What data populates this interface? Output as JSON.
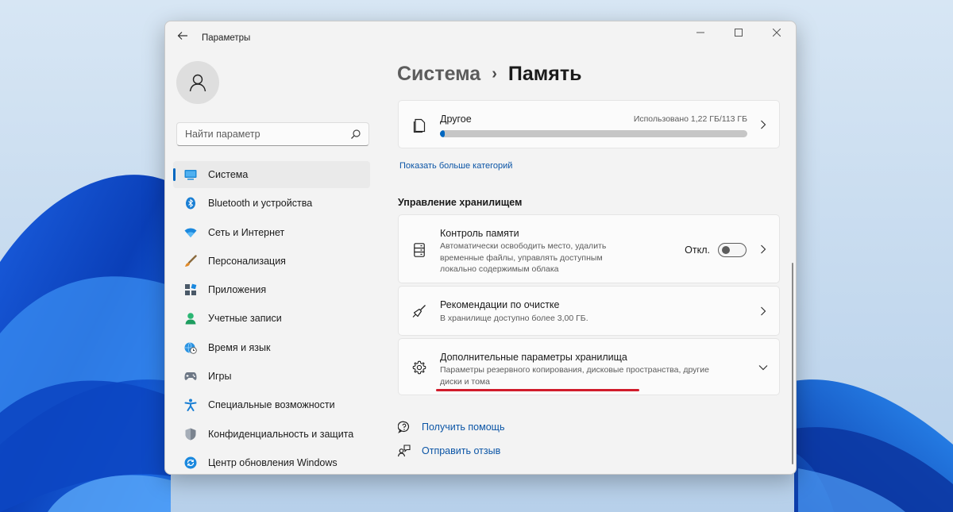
{
  "window": {
    "app_title": "Параметры",
    "controls": {
      "minimize": "minimize-icon",
      "maximize": "maximize-icon",
      "close": "close-icon"
    }
  },
  "sidebar": {
    "search_placeholder": "Найти параметр",
    "items": [
      {
        "label": "Система",
        "icon": "system-icon",
        "active": true
      },
      {
        "label": "Bluetooth и устройства",
        "icon": "bluetooth-icon"
      },
      {
        "label": "Сеть и Интернет",
        "icon": "wifi-icon"
      },
      {
        "label": "Персонализация",
        "icon": "brush-icon"
      },
      {
        "label": "Приложения",
        "icon": "apps-icon"
      },
      {
        "label": "Учетные записи",
        "icon": "account-icon"
      },
      {
        "label": "Время и язык",
        "icon": "globe-clock-icon"
      },
      {
        "label": "Игры",
        "icon": "gamepad-icon"
      },
      {
        "label": "Специальные возможности",
        "icon": "accessibility-icon"
      },
      {
        "label": "Конфиденциальность и защита",
        "icon": "shield-icon"
      },
      {
        "label": "Центр обновления Windows",
        "icon": "update-icon"
      }
    ]
  },
  "breadcrumb": {
    "parent": "Система",
    "separator": "›",
    "current": "Память"
  },
  "other_card": {
    "title": "Другое",
    "usage": "Использовано 1,22 ГБ/113 ГБ",
    "progress_fraction": 0.011
  },
  "show_more_link": "Показать больше категорий",
  "storage_management": {
    "section_title": "Управление хранилищем",
    "storage_sense": {
      "title": "Контроль памяти",
      "desc": "Автоматически освободить место, удалить временные файлы, управлять доступным локально содержимым облака",
      "toggle_label": "Откл.",
      "toggle_on": false
    },
    "cleanup": {
      "title": "Рекомендации по очистке",
      "desc": "В хранилище доступно более 3,00 ГБ."
    },
    "advanced": {
      "title": "Дополнительные параметры хранилища",
      "desc": "Параметры резервного копирования, дисковые пространства, другие диски и тома"
    }
  },
  "help": {
    "get_help": "Получить помощь",
    "feedback": "Отправить отзыв"
  },
  "colors": {
    "accent": "#0067c0",
    "highlight": "#d11c2c"
  }
}
